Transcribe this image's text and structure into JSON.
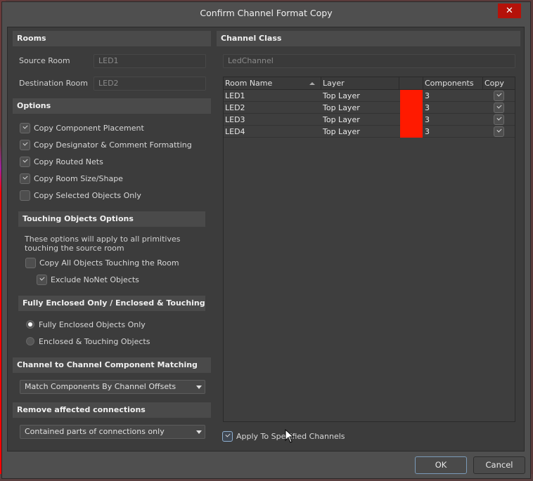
{
  "window": {
    "title": "Confirm Channel Format Copy",
    "close_label": "✕"
  },
  "rooms": {
    "header": "Rooms",
    "source_label": "Source Room",
    "source_value": "LED1",
    "destination_label": "Destination Room",
    "destination_value": "LED2"
  },
  "options": {
    "header": "Options",
    "items": [
      {
        "label": "Copy Component Placement",
        "checked": true
      },
      {
        "label": "Copy Designator & Comment Formatting",
        "checked": true
      },
      {
        "label": "Copy Routed Nets",
        "checked": true
      },
      {
        "label": "Copy Room Size/Shape",
        "checked": true
      },
      {
        "label": "Copy Selected Objects Only",
        "checked": false
      }
    ]
  },
  "touching": {
    "header": "Touching Objects Options",
    "description_line1": "These options will apply to all primitives",
    "description_line2": "touching the source room",
    "copy_all_label": "Copy All Objects Touching the Room",
    "copy_all_checked": false,
    "exclude_nonet_label": "Exclude NoNet Objects",
    "exclude_nonet_checked": true
  },
  "enclosure": {
    "header": "Fully Enclosed Only / Enclosed & Touching",
    "options": [
      {
        "label": "Fully Enclosed Objects Only",
        "selected": true
      },
      {
        "label": "Enclosed & Touching Objects",
        "selected": false
      }
    ]
  },
  "matching": {
    "header": "Channel to Channel Component Matching",
    "selected": "Match Components By Channel Offsets"
  },
  "connections": {
    "header": "Remove affected connections",
    "selected": "Contained parts of connections only"
  },
  "channel_class": {
    "header": "Channel Class",
    "value": "LedChannel"
  },
  "table": {
    "columns": [
      "Room Name",
      "Layer",
      "",
      "Components",
      "Copy"
    ],
    "rows": [
      {
        "room": "LED1",
        "layer": "Top Layer",
        "color": "#ff1a00",
        "components": "3",
        "copy": true
      },
      {
        "room": "LED2",
        "layer": "Top Layer",
        "color": "#ff1a00",
        "components": "3",
        "copy": true
      },
      {
        "room": "LED3",
        "layer": "Top Layer",
        "color": "#ff1a00",
        "components": "3",
        "copy": true
      },
      {
        "room": "LED4",
        "layer": "Top Layer",
        "color": "#ff1a00",
        "components": "3",
        "copy": true
      }
    ]
  },
  "apply_specified": {
    "label": "Apply To Specified Channels",
    "checked": true
  },
  "buttons": {
    "ok": "OK",
    "cancel": "Cancel"
  }
}
